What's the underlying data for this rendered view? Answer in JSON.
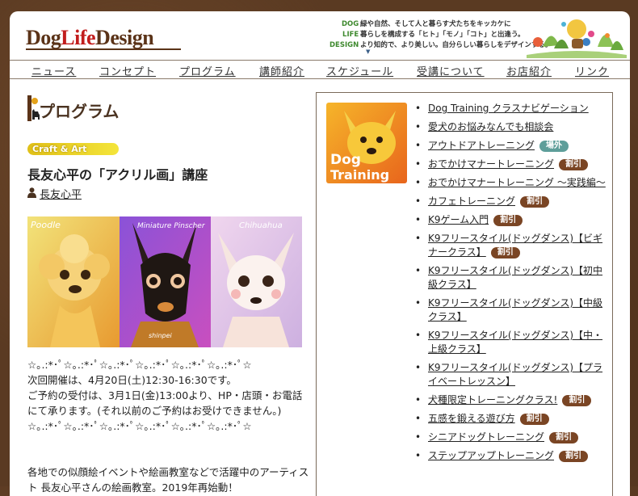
{
  "header": {
    "logo_dog": "Dog",
    "logo_life": "Life",
    "logo_design": "Design",
    "tag_dog": "DOG",
    "tag_life": "LIFE",
    "tag_design": "DESIGN",
    "tag_line1": "緑や自然、そして人と暮らす犬たちをキッカケに",
    "tag_line2": "暮らしを構成する「ヒト」「モノ」「コト」と出逢う。",
    "tag_line3": "より知的で、より美しい。自分らしい暮らしをデザインする。"
  },
  "nav": {
    "items": [
      "ニュース",
      "コンセプト",
      "プログラム",
      "講師紹介",
      "スケジュール",
      "受講について",
      "お店紹介",
      "リンク"
    ]
  },
  "main": {
    "section_title": "プログラム",
    "category_badge": "Craft & Art",
    "lecture_title": "長友心平の「アクリル画」講座",
    "instructor": "長友心平",
    "artwork_labels": [
      "Poodle",
      "Miniature Pinscher",
      "Chihuahua",
      "shinpei"
    ],
    "body": [
      "☆｡.:*･ﾟ☆｡.:*･ﾟ☆｡.:*･ﾟ☆｡.:*･ﾟ☆｡.:*･ﾟ☆｡.:*･ﾟ☆",
      "次回開催は、4月20日(土)12:30-16:30です。",
      "ご予約の受付は、3月1日(金)13:00より、HP・店頭・お電話にて承ります。(それ以前のご予約はお受けできません。)",
      "☆｡.:*･ﾟ☆｡.:*･ﾟ☆｡.:*･ﾟ☆｡.:*･ﾟ☆｡.:*･ﾟ☆｡.:*･ﾟ☆",
      "",
      "各地での似顔絵イベントや絵画教室などで活躍中のアーティスト 長友心平さんの絵画教室。2019年再始動！"
    ]
  },
  "sidebar": {
    "banner_line1": "Dog",
    "banner_line2": "Training",
    "items": [
      {
        "label": "Dog Training クラスナビゲーション",
        "badge": ""
      },
      {
        "label": "愛犬のお悩みなんでも相談会",
        "badge": ""
      },
      {
        "label": "アウトドアトレーニング",
        "badge": "場外",
        "badge_color": "teal"
      },
      {
        "label": "おでかけマナートレーニング",
        "badge": "割引",
        "badge_color": "brown"
      },
      {
        "label": "おでかけマナートレーニング 〜実践編〜",
        "badge": ""
      },
      {
        "label": "カフェトレーニング",
        "badge": "割引",
        "badge_color": "brown"
      },
      {
        "label": "K9ゲーム入門",
        "badge": "割引",
        "badge_color": "brown"
      },
      {
        "label": "K9フリースタイル(ドッグダンス)【ビギナークラス】",
        "badge": "割引",
        "badge_color": "brown"
      },
      {
        "label": "K9フリースタイル(ドッグダンス)【初中級クラス】",
        "badge": ""
      },
      {
        "label": "K9フリースタイル(ドッグダンス)【中級クラス】",
        "badge": ""
      },
      {
        "label": "K9フリースタイル(ドッグダンス)【中・上級クラス】",
        "badge": ""
      },
      {
        "label": "K9フリースタイル(ドッグダンス)【プライベートレッスン】",
        "badge": ""
      },
      {
        "label": "犬種限定トレーニングクラス!",
        "badge": "割引",
        "badge_color": "brown"
      },
      {
        "label": "五感を鍛える遊び方",
        "badge": "割引",
        "badge_color": "brown"
      },
      {
        "label": "シニアドッグトレーニング",
        "badge": "割引",
        "badge_color": "brown"
      },
      {
        "label": "ステップアップトレーニング",
        "badge": "割引",
        "badge_color": "brown"
      }
    ]
  },
  "colors": {
    "brand_brown": "#5b3318",
    "logo_red": "#c21d1d",
    "badge_brown": "#7a4524",
    "badge_teal": "#5e9e9a",
    "craft_yellow": "#f4e53b"
  }
}
